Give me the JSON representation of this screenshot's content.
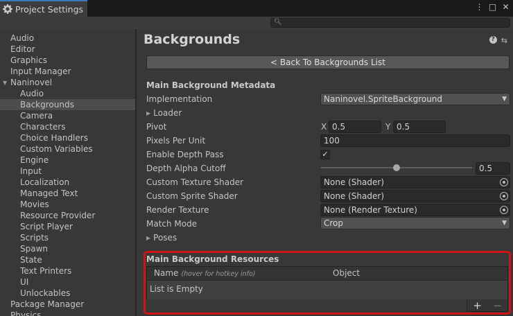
{
  "window": {
    "tab_title": "Project Settings",
    "controls": [
      "⋮",
      "□",
      "✕"
    ]
  },
  "search": {
    "placeholder": ""
  },
  "sidebar": {
    "items": [
      {
        "label": "Audio",
        "level": 0
      },
      {
        "label": "Editor",
        "level": 0
      },
      {
        "label": "Graphics",
        "level": 0
      },
      {
        "label": "Input Manager",
        "level": 0
      },
      {
        "label": "Naninovel",
        "level": 0,
        "expanded": true
      },
      {
        "label": "Audio",
        "level": 1
      },
      {
        "label": "Backgrounds",
        "level": 1,
        "selected": true
      },
      {
        "label": "Camera",
        "level": 1
      },
      {
        "label": "Characters",
        "level": 1
      },
      {
        "label": "Choice Handlers",
        "level": 1
      },
      {
        "label": "Custom Variables",
        "level": 1
      },
      {
        "label": "Engine",
        "level": 1
      },
      {
        "label": "Input",
        "level": 1
      },
      {
        "label": "Localization",
        "level": 1
      },
      {
        "label": "Managed Text",
        "level": 1
      },
      {
        "label": "Movies",
        "level": 1
      },
      {
        "label": "Resource Provider",
        "level": 1
      },
      {
        "label": "Script Player",
        "level": 1
      },
      {
        "label": "Scripts",
        "level": 1
      },
      {
        "label": "Spawn",
        "level": 1
      },
      {
        "label": "State",
        "level": 1
      },
      {
        "label": "Text Printers",
        "level": 1
      },
      {
        "label": "UI",
        "level": 1
      },
      {
        "label": "Unlockables",
        "level": 1
      },
      {
        "label": "Package Manager",
        "level": 0
      },
      {
        "label": "Physics",
        "level": 0
      }
    ]
  },
  "main": {
    "title": "Backgrounds",
    "back_button": "< Back To Backgrounds List",
    "metadata_header": "Main Background Metadata",
    "implementation": {
      "label": "Implementation",
      "value": "Naninovel.SpriteBackground"
    },
    "loader": {
      "label": "Loader"
    },
    "pivot": {
      "label": "Pivot",
      "x_label": "X",
      "x": "0.5",
      "y_label": "Y",
      "y": "0.5"
    },
    "ppu": {
      "label": "Pixels Per Unit",
      "value": "100"
    },
    "depth_pass": {
      "label": "Enable Depth Pass",
      "checked": "✓"
    },
    "depth_alpha": {
      "label": "Depth Alpha Cutoff",
      "value": "0.5",
      "slider_fraction": 0.5
    },
    "tex_shader": {
      "label": "Custom Texture Shader",
      "value": "None (Shader)"
    },
    "sprite_shader": {
      "label": "Custom Sprite Shader",
      "value": "None (Shader)"
    },
    "render_texture": {
      "label": "Render Texture",
      "value": "None (Render Texture)"
    },
    "match_mode": {
      "label": "Match Mode",
      "value": "Crop"
    },
    "poses": {
      "label": "Poses"
    },
    "resources": {
      "header": "Main Background Resources",
      "col_name": "Name",
      "col_hint": "(hover for hotkey info)",
      "col_object": "Object",
      "empty_text": "List is Empty",
      "add": "+",
      "remove": "−"
    }
  },
  "colors": {
    "accent": "#3a79bb",
    "highlight_border": "#d01414",
    "background": "#383838"
  }
}
